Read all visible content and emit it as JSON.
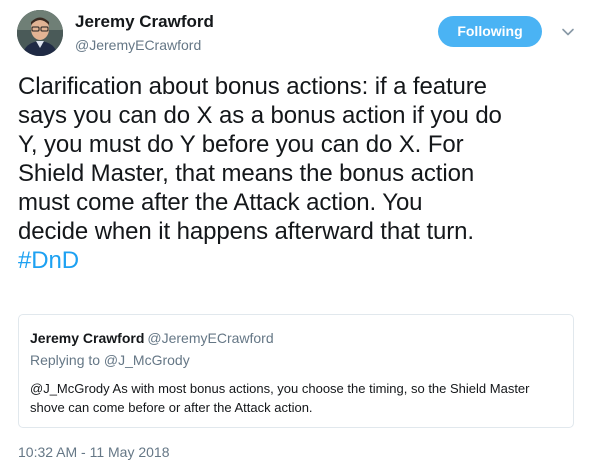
{
  "author": {
    "display_name": "Jeremy Crawford",
    "handle": "@JeremyECrawford"
  },
  "follow_button": {
    "label": "Following",
    "color": "#4ab3f4"
  },
  "menu": {
    "icon": "chevron-down-icon"
  },
  "tweet": {
    "lines": [
      "Clarification about bonus actions: if a feature",
      "says you can do X as a bonus action if you do",
      "Y, you must do Y before you can do X. For",
      "Shield Master, that means the bonus action",
      "must come after the Attack action. You",
      "decide when it happens afterward that turn."
    ],
    "hashtag": "#DnD",
    "hashtag_color": "#1da1f2"
  },
  "quoted_tweet": {
    "display_name": "Jeremy Crawford",
    "handle": "@JeremyECrawford",
    "reply_context": "Replying to @J_McGrody",
    "body_lines": [
      "@J_McGrody As with most bonus actions, you choose the timing, so the Shield Master",
      "shove can come before or after the Attack action."
    ]
  },
  "timestamp": "10:32 AM - 11 May 2018"
}
